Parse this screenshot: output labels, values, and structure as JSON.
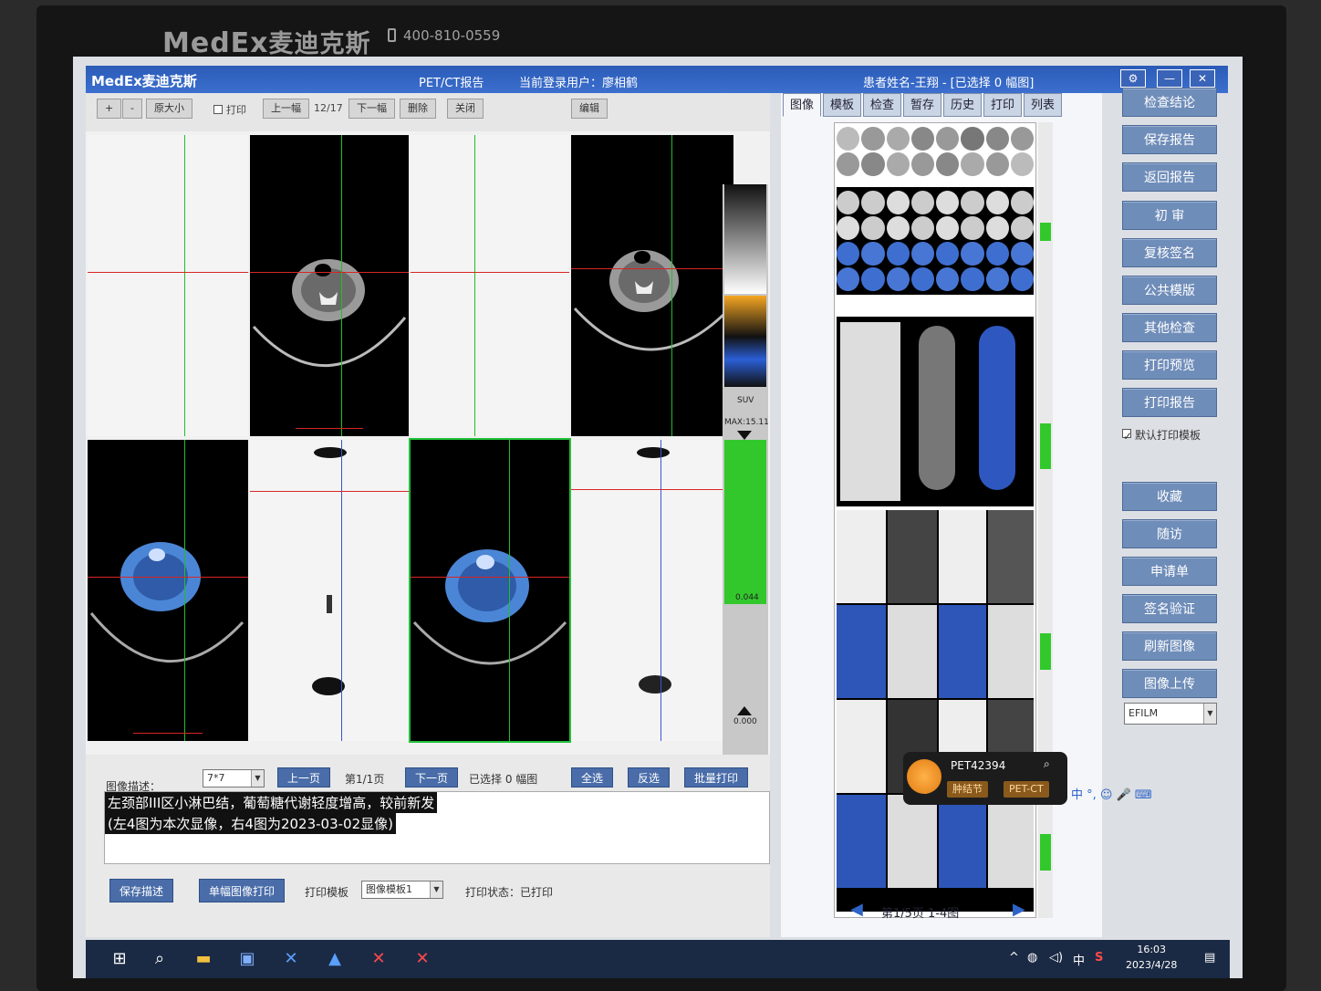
{
  "monitor": {
    "brand": "MedEx",
    "brand_cn": "麦迪克斯",
    "phone": "400-810-0559"
  },
  "app": {
    "logo": "MedEx麦迪克斯",
    "title": "PET/CT报告",
    "current_user": "当前登录用户：廖相鹤",
    "patient": "患者姓名-王翔 - [已选择 0 幅图]"
  },
  "toolbar": {
    "original_size": "原大小",
    "print_label": "打印",
    "prev_frame": "上一幅",
    "page_counter": "12/17",
    "next_frame": "下一幅",
    "delete": "删除",
    "close": "关闭",
    "edit": "编辑"
  },
  "colorbar": {
    "suv_label": "SUV",
    "max_label": "MAX:15.11",
    "mid_value": "0.044",
    "min_value": "0.000"
  },
  "bottom": {
    "desc_label": "图像描述：",
    "layout_select": "7*7",
    "prev_page": "上一页",
    "page_info": "第1/1页",
    "next_page": "下一页",
    "selected_info": "已选择 0 幅图",
    "select_all": "全选",
    "invert": "反选",
    "batch_print": "批量打印",
    "description_lines": [
      "左颈部III区小淋巴结，葡萄糖代谢轻度增高，较前新发",
      "(左4图为本次显像，右4图为2023-03-02显像)"
    ],
    "save_desc": "保存描述",
    "single_print": "单幅图像打印",
    "print_template_label": "打印模板",
    "print_template_value": "图像模板1",
    "print_status": "打印状态：已打印"
  },
  "tabs": [
    "图像",
    "模板",
    "检查",
    "暂存",
    "历史",
    "打印",
    "列表"
  ],
  "pager": {
    "text": "第1/5页 1-4图"
  },
  "right_buttons": [
    "检查结论",
    "保存报告",
    "返回报告",
    "初 审",
    "复核签名",
    "公共模版",
    "其他检查",
    "打印预览",
    "打印报告"
  ],
  "right_buttons_2": [
    "收藏",
    "随访",
    "申请单",
    "签名验证",
    "刷新图像",
    "图像上传"
  ],
  "default_print_template": "默认打印模板",
  "viewer_select": "EFILM",
  "chip": {
    "id": "PET42394",
    "tag1": "肿结节",
    "tag2": "PET-CT"
  },
  "ime": "中 °, ☺ 🎤 ⌨",
  "taskbar": {
    "time": "16:03",
    "date": "2023/4/28",
    "ime_lang": "中"
  }
}
